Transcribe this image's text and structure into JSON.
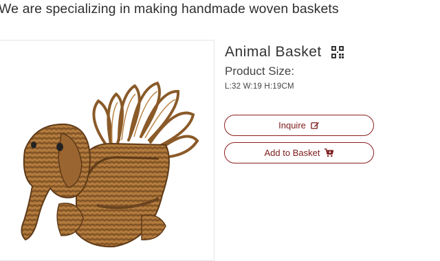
{
  "header": {
    "tagline": "We are specializing in making handmade woven baskets"
  },
  "product": {
    "title": "Animal Basket",
    "size_label": "Product Size:",
    "size_value": "L:32 W:19 H:19CM",
    "image_icon": "elephant-wicker-basket-image"
  },
  "actions": {
    "inquire_label": "Inquire",
    "inquire_icon": "edit-icon",
    "add_label": "Add to Basket",
    "add_icon": "cart-plus-icon"
  },
  "colors": {
    "accent": "#8c1d1d",
    "wicker": "#a06d35",
    "wicker_dark": "#6b4420"
  }
}
